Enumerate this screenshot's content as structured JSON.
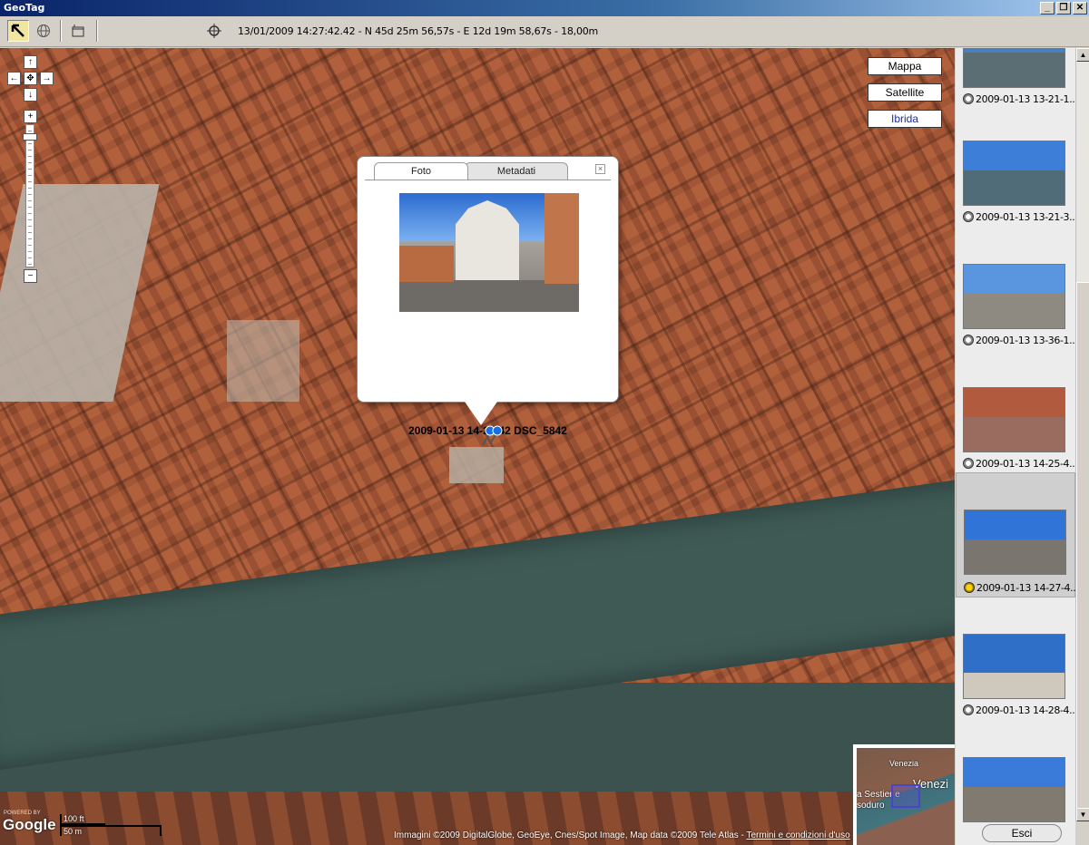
{
  "window": {
    "title": "GeoTag",
    "controls": [
      "minimize",
      "maximize",
      "close"
    ]
  },
  "toolbar": {
    "tools": [
      {
        "name": "select-arrow-tool",
        "active": true
      },
      {
        "name": "globe-tool",
        "active": false
      },
      {
        "name": "window-tool",
        "active": false
      },
      {
        "name": "crosshair-tool",
        "active": false
      }
    ],
    "coordinates": "13/01/2009 14:27:42.42 - N 45d 25m 56,57s - E 12d 19m 58,67s - 18,00m"
  },
  "map": {
    "type_buttons": [
      {
        "label": "Mappa",
        "selected": false
      },
      {
        "label": "Satellite",
        "selected": false
      },
      {
        "label": "Ibrida",
        "selected": true
      }
    ],
    "zoom_level": 0.93,
    "info_window": {
      "tabs": [
        "Foto",
        "Metadati"
      ],
      "active_tab": "Foto",
      "caption": "2009-01-13 14-27-42 DSC_5842"
    },
    "powered_by": "POWERED BY",
    "logo": "Google",
    "scale": {
      "imperial": "100 ft",
      "metric": "50 m"
    },
    "copyright": "Immagini ©2009 DigitalGlobe, GeoEye, Cnes/Spot Image, Map data ©2009 Tele Atlas -",
    "terms_link": "Termini e condizioni d'uso",
    "overview": {
      "labels": [
        "Venezia",
        "Venezi",
        "a Sestier e",
        "soduro"
      ]
    }
  },
  "thumbnails": [
    {
      "label": "2009-01-13 13-21-1...",
      "selected": false
    },
    {
      "label": "2009-01-13 13-21-3...",
      "selected": false
    },
    {
      "label": "2009-01-13 13-36-1...",
      "selected": false
    },
    {
      "label": "2009-01-13 14-25-4...",
      "selected": false
    },
    {
      "label": "2009-01-13 14-27-4...",
      "selected": true
    },
    {
      "label": "2009-01-13 14-28-4...",
      "selected": false
    },
    {
      "label": "",
      "selected": false
    }
  ],
  "exit_button": "Esci"
}
